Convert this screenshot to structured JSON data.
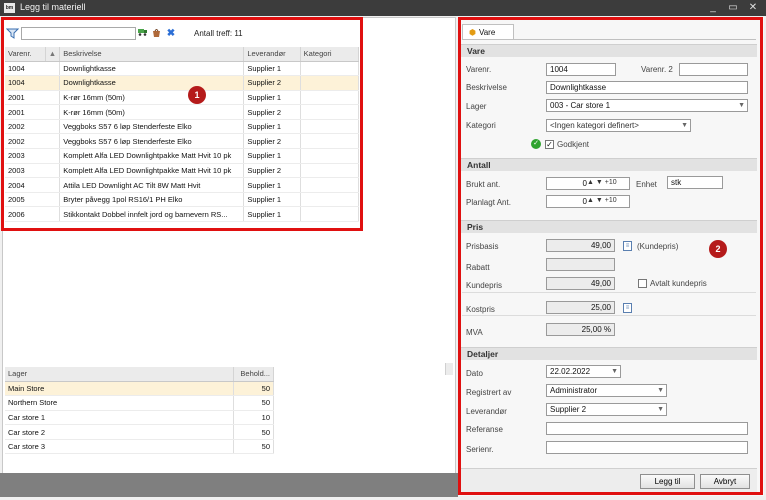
{
  "window": {
    "app_icon": "bm",
    "title": "Legg til materiell",
    "controls": {
      "minimize": "_",
      "maximize": "▭",
      "close": "✕"
    }
  },
  "toolbar": {
    "search_value": "",
    "hits_label": "Antall treff: 11",
    "icons": [
      "filter-icon",
      "truck-icon",
      "bag-icon",
      "clear-icon"
    ]
  },
  "products": {
    "columns": [
      "Varenr.",
      "▲",
      "Beskrivelse",
      "Leverandør",
      "Kategori"
    ],
    "rows": [
      {
        "nr": "1004",
        "desc": "Downlightkasse",
        "supplier": "Supplier 1",
        "cat": ""
      },
      {
        "nr": "1004",
        "desc": "Downlightkasse",
        "supplier": "Supplier 2",
        "cat": ""
      },
      {
        "nr": "2001",
        "desc": "K-rør 16mm (50m)",
        "supplier": "Supplier 1",
        "cat": ""
      },
      {
        "nr": "2001",
        "desc": "K-rør 16mm (50m)",
        "supplier": "Supplier 2",
        "cat": ""
      },
      {
        "nr": "2002",
        "desc": "Veggboks S57 6 løp Stenderfeste Elko",
        "supplier": "Supplier 1",
        "cat": ""
      },
      {
        "nr": "2002",
        "desc": "Veggboks S57 6 løp Stenderfeste Elko",
        "supplier": "Supplier 2",
        "cat": ""
      },
      {
        "nr": "2003",
        "desc": "Komplett Alfa LED Downlightpakke Matt Hvit 10 pk",
        "supplier": "Supplier 1",
        "cat": ""
      },
      {
        "nr": "2003",
        "desc": "Komplett Alfa LED Downlightpakke Matt Hvit 10 pk",
        "supplier": "Supplier 2",
        "cat": ""
      },
      {
        "nr": "2004",
        "desc": "Attila LED Downlight AC Tilt 8W Matt Hvit",
        "supplier": "Supplier 1",
        "cat": ""
      },
      {
        "nr": "2005",
        "desc": "Bryter påvegg 1pol RS16/1 PH Elko",
        "supplier": "Supplier 1",
        "cat": ""
      },
      {
        "nr": "2006",
        "desc": "Stikkontakt Dobbel innfelt jord og barnevern RS...",
        "supplier": "Supplier 1",
        "cat": ""
      }
    ]
  },
  "stock": {
    "columns": [
      "Lager",
      "Behold..."
    ],
    "rows": [
      {
        "name": "Main Store",
        "qty": "50"
      },
      {
        "name": "Northern Store",
        "qty": "50"
      },
      {
        "name": "Car store 1",
        "qty": "10"
      },
      {
        "name": "Car store 2",
        "qty": "50"
      },
      {
        "name": "Car store 3",
        "qty": "50"
      }
    ]
  },
  "badges": {
    "one": "1",
    "two": "2"
  },
  "accent": {
    "highlight": "#e01010",
    "badge": "#b51b1b",
    "selected_row": "#fdf2d8"
  },
  "form": {
    "tab_label": "Vare",
    "sections": {
      "vare": "Vare",
      "antall": "Antall",
      "pris": "Pris",
      "detaljer": "Detaljer"
    },
    "labels": {
      "varenr": "Varenr.",
      "varenr2": "Varenr. 2",
      "beskrivelse": "Beskrivelse",
      "lager": "Lager",
      "kategori": "Kategori",
      "godkjent": "Godkjent",
      "brukt": "Brukt ant.",
      "enhet": "Enhet",
      "planlagt": "Planlagt Ant.",
      "prisbasis": "Prisbasis",
      "kundepris_hint": "(Kundepris)",
      "rabatt": "Rabatt",
      "kundepris": "Kundepris",
      "avtalt": "Avtalt kundepris",
      "kostpris": "Kostpris",
      "mva": "MVA",
      "dato": "Dato",
      "registrert": "Registrert av",
      "leverandor": "Leverandør",
      "referanse": "Referanse",
      "serienr": "Serienr."
    },
    "values": {
      "varenr": "1004",
      "varenr2": "",
      "beskrivelse": "Downlightkasse",
      "lager": "003 - Car store 1",
      "kategori": "<Ingen kategori definert>",
      "godkjent": true,
      "brukt": "0",
      "enhet": "stk",
      "planlagt": "0",
      "spin_step": "+10",
      "prisbasis": "49,00",
      "rabatt": "",
      "kundepris": "49,00",
      "avtalt": false,
      "kostpris": "25,00",
      "mva": "25,00 %",
      "dato": "22.02.2022",
      "registrert": "Administrator",
      "leverandor": "Supplier 2",
      "referanse": "",
      "serienr": ""
    },
    "buttons": {
      "add": "Legg til",
      "cancel": "Avbryt"
    }
  }
}
